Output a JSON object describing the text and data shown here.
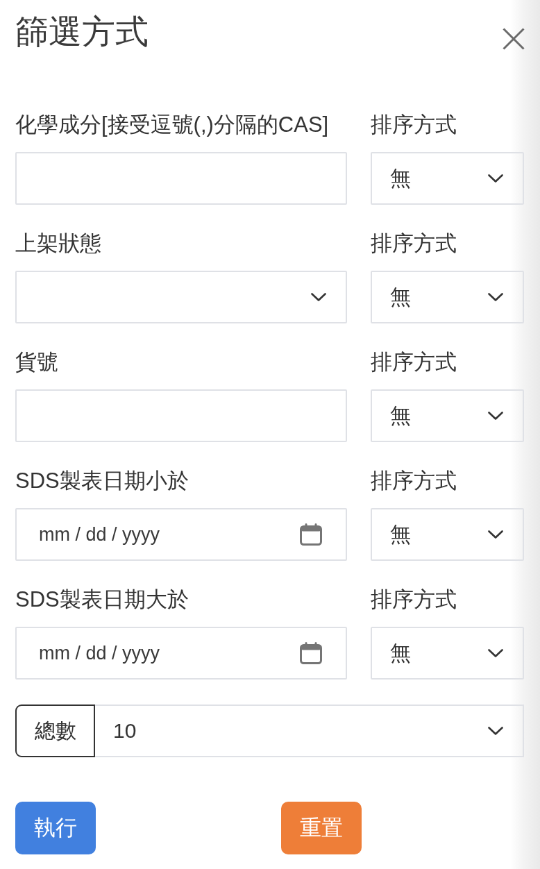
{
  "panel": {
    "title": "篩選方式"
  },
  "filters": [
    {
      "label": "化學成分[接受逗號(,)分隔的CAS]",
      "kind": "text",
      "sort": {
        "label": "排序方式",
        "value": "無"
      }
    },
    {
      "label": "上架狀態",
      "kind": "select",
      "sort": {
        "label": "排序方式",
        "value": "無"
      }
    },
    {
      "label": "貨號",
      "kind": "text",
      "sort": {
        "label": "排序方式",
        "value": "無"
      }
    },
    {
      "label": "SDS製表日期小於",
      "kind": "date",
      "placeholder": "mm / dd / yyyy",
      "sort": {
        "label": "排序方式",
        "value": "無"
      }
    },
    {
      "label": "SDS製表日期大於",
      "kind": "date",
      "placeholder": "mm / dd / yyyy",
      "sort": {
        "label": "排序方式",
        "value": "無"
      }
    }
  ],
  "total": {
    "label": "總數",
    "value": "10"
  },
  "buttons": [
    {
      "label": "執行",
      "kind": "primary"
    },
    {
      "label": "重置",
      "kind": "warning"
    }
  ]
}
